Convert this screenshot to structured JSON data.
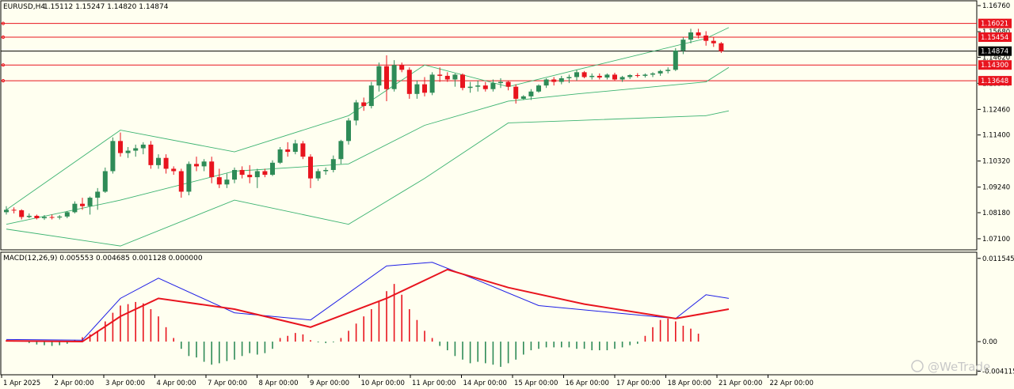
{
  "header": {
    "symbol": "EURUSD,H4",
    "ohlc": "1.15112 1.15247 1.14820 1.14874"
  },
  "macd_header": "MACD(12,26,9) 0.005553 0.004685 0.001128 0.000000",
  "watermark": "@WeTrade",
  "colors": {
    "background": "#fffff0",
    "bull": "#2e8b57",
    "bear": "#e8141e",
    "band": "#3cb371",
    "level": "#e8141e",
    "macd_line": "#1e1ee6",
    "signal_line": "#e8141e",
    "macd_hist": "#e8141e"
  },
  "chart_data": [
    {
      "type": "candlestick",
      "title": "EURUSD,H4",
      "ylim": [
        1.0664,
        1.1696
      ],
      "yticks": [
        "1.16760",
        "1.15680",
        "1.14620",
        "1.13540",
        "1.12460",
        "1.11400",
        "1.10320",
        "1.09240",
        "1.08180",
        "1.07100"
      ],
      "xticks": [
        "1 Apr 2025",
        "2 Apr 00:00",
        "3 Apr 00:00",
        "4 Apr 00:00",
        "7 Apr 00:00",
        "8 Apr 00:00",
        "9 Apr 00:00",
        "10 Apr 00:00",
        "11 Apr 00:00",
        "14 Apr 00:00",
        "15 Apr 00:00",
        "16 Apr 00:00",
        "17 Apr 00:00",
        "18 Apr 00:00",
        "21 Apr 00:00",
        "22 Apr 00:00"
      ],
      "price_levels": [
        {
          "value": 1.16021,
          "label": "1.16021",
          "style": "red"
        },
        {
          "value": 1.15454,
          "label": "1.15454",
          "style": "red"
        },
        {
          "value": 1.14874,
          "label": "1.14874",
          "style": "current"
        },
        {
          "value": 1.143,
          "label": "1.14300",
          "style": "red"
        },
        {
          "value": 1.13648,
          "label": "1.13648",
          "style": "red"
        }
      ],
      "candles": [
        [
          1.082,
          1.0845,
          1.081,
          1.083
        ],
        [
          1.083,
          1.084,
          1.0815,
          1.0828
        ],
        [
          1.0828,
          1.0832,
          1.079,
          1.08
        ],
        [
          1.08,
          1.0815,
          1.0795,
          1.0805
        ],
        [
          1.0805,
          1.081,
          1.079,
          1.0795
        ],
        [
          1.0795,
          1.0808,
          1.0788,
          1.08
        ],
        [
          1.08,
          1.081,
          1.079,
          1.0798
        ],
        [
          1.0798,
          1.0808,
          1.079,
          1.0802
        ],
        [
          1.0802,
          1.0825,
          1.0795,
          1.082
        ],
        [
          1.082,
          1.0865,
          1.0815,
          1.0855
        ],
        [
          1.0855,
          1.088,
          1.083,
          1.0845
        ],
        [
          1.0845,
          1.0885,
          1.081,
          1.088
        ],
        [
          1.088,
          1.092,
          1.083,
          1.0905
        ],
        [
          1.0905,
          1.1005,
          1.09,
          1.099
        ],
        [
          1.099,
          1.113,
          1.098,
          1.1115
        ],
        [
          1.1115,
          1.115,
          1.105,
          1.1065
        ],
        [
          1.1065,
          1.109,
          1.1045,
          1.1075
        ],
        [
          1.1075,
          1.11,
          1.105,
          1.1085
        ],
        [
          1.1085,
          1.111,
          1.106,
          1.11
        ],
        [
          1.11,
          1.1115,
          1.1,
          1.1015
        ],
        [
          1.1015,
          1.106,
          1.1,
          1.1045
        ],
        [
          1.1045,
          1.106,
          1.098,
          1.1
        ],
        [
          1.1,
          1.101,
          1.0975,
          1.099
        ],
        [
          1.099,
          1.1,
          1.088,
          1.0905
        ],
        [
          1.0905,
          1.103,
          1.089,
          1.102
        ],
        [
          1.102,
          1.105,
          1.099,
          1.101
        ],
        [
          1.101,
          1.104,
          1.099,
          1.103
        ],
        [
          1.103,
          1.105,
          1.094,
          1.0965
        ],
        [
          1.0965,
          1.1,
          1.092,
          1.0935
        ],
        [
          1.0935,
          1.098,
          1.092,
          1.0955
        ],
        [
          1.0955,
          1.1005,
          1.094,
          1.0995
        ],
        [
          1.0995,
          1.101,
          1.096,
          1.0975
        ],
        [
          1.0975,
          1.1015,
          1.094,
          1.0965
        ],
        [
          1.0965,
          1.1,
          1.092,
          1.099
        ],
        [
          1.099,
          1.1,
          1.0965,
          1.0975
        ],
        [
          1.0975,
          1.1035,
          1.097,
          1.1025
        ],
        [
          1.1025,
          1.109,
          1.102,
          1.108
        ],
        [
          1.108,
          1.111,
          1.105,
          1.107
        ],
        [
          1.107,
          1.112,
          1.106,
          1.1105
        ],
        [
          1.1105,
          1.1115,
          1.104,
          1.105
        ],
        [
          1.105,
          1.106,
          1.092,
          1.096
        ],
        [
          1.096,
          1.1,
          1.095,
          1.099
        ],
        [
          1.099,
          1.1005,
          1.0975,
          1.0995
        ],
        [
          1.0995,
          1.1055,
          1.0985,
          1.104
        ],
        [
          1.104,
          1.112,
          1.102,
          1.1115
        ],
        [
          1.1115,
          1.121,
          1.11,
          1.12
        ],
        [
          1.12,
          1.1285,
          1.118,
          1.1275
        ],
        [
          1.1275,
          1.1295,
          1.124,
          1.126
        ],
        [
          1.126,
          1.136,
          1.125,
          1.1345
        ],
        [
          1.1345,
          1.144,
          1.132,
          1.1425
        ],
        [
          1.1425,
          1.147,
          1.128,
          1.133
        ],
        [
          1.133,
          1.145,
          1.132,
          1.143
        ],
        [
          1.143,
          1.144,
          1.14,
          1.141
        ],
        [
          1.141,
          1.142,
          1.129,
          1.131
        ],
        [
          1.131,
          1.1365,
          1.129,
          1.135
        ],
        [
          1.135,
          1.138,
          1.13,
          1.1315
        ],
        [
          1.1315,
          1.14,
          1.1305,
          1.139
        ],
        [
          1.139,
          1.142,
          1.136,
          1.1385
        ],
        [
          1.1385,
          1.14,
          1.136,
          1.137
        ],
        [
          1.137,
          1.1395,
          1.134,
          1.139
        ],
        [
          1.139,
          1.1395,
          1.1325,
          1.1335
        ],
        [
          1.1335,
          1.136,
          1.1315,
          1.134
        ],
        [
          1.134,
          1.1365,
          1.132,
          1.1345
        ],
        [
          1.1345,
          1.136,
          1.132,
          1.133
        ],
        [
          1.133,
          1.137,
          1.132,
          1.1355
        ],
        [
          1.1355,
          1.1375,
          1.1335,
          1.136
        ],
        [
          1.136,
          1.1365,
          1.1325,
          1.134
        ],
        [
          1.134,
          1.135,
          1.127,
          1.129
        ],
        [
          1.129,
          1.1305,
          1.1285,
          1.13
        ],
        [
          1.13,
          1.133,
          1.1285,
          1.132
        ],
        [
          1.132,
          1.135,
          1.1315,
          1.1345
        ],
        [
          1.1345,
          1.1375,
          1.1335,
          1.137
        ],
        [
          1.137,
          1.138,
          1.1345,
          1.136
        ],
        [
          1.136,
          1.1385,
          1.135,
          1.1375
        ],
        [
          1.1375,
          1.139,
          1.1355,
          1.138
        ],
        [
          1.138,
          1.141,
          1.1365,
          1.14
        ],
        [
          1.14,
          1.1405,
          1.1375,
          1.138
        ],
        [
          1.138,
          1.1395,
          1.137,
          1.1385
        ],
        [
          1.1385,
          1.1395,
          1.137,
          1.1378
        ],
        [
          1.1378,
          1.1395,
          1.137,
          1.139
        ],
        [
          1.139,
          1.1398,
          1.1365,
          1.137
        ],
        [
          1.137,
          1.1385,
          1.136,
          1.138
        ],
        [
          1.138,
          1.1392,
          1.1372,
          1.1388
        ],
        [
          1.1388,
          1.1396,
          1.1378,
          1.1385
        ],
        [
          1.1385,
          1.1395,
          1.1378,
          1.139
        ],
        [
          1.139,
          1.14,
          1.138,
          1.1395
        ],
        [
          1.1395,
          1.141,
          1.1385,
          1.1405
        ],
        [
          1.1405,
          1.142,
          1.1395,
          1.141
        ],
        [
          1.141,
          1.15,
          1.1405,
          1.149
        ],
        [
          1.149,
          1.1545,
          1.1475,
          1.1535
        ],
        [
          1.1535,
          1.158,
          1.152,
          1.1565
        ],
        [
          1.1565,
          1.158,
          1.154,
          1.1552
        ],
        [
          1.1552,
          1.157,
          1.151,
          1.153
        ],
        [
          1.153,
          1.1545,
          1.1505,
          1.152
        ],
        [
          1.152,
          1.1525,
          1.148,
          1.1487
        ]
      ],
      "bollinger": {
        "upper": [
          [
            0,
            1.083
          ],
          [
            15,
            1.116
          ],
          [
            30,
            1.107
          ],
          [
            45,
            1.122
          ],
          [
            55,
            1.143
          ],
          [
            66,
            1.134
          ],
          [
            75,
            1.141
          ],
          [
            92,
            1.154
          ],
          [
            95,
            1.1585
          ]
        ],
        "middle": [
          [
            0,
            1.077
          ],
          [
            15,
            1.087
          ],
          [
            30,
            1.099
          ],
          [
            45,
            1.102
          ],
          [
            55,
            1.118
          ],
          [
            66,
            1.128
          ],
          [
            75,
            1.131
          ],
          [
            92,
            1.136
          ],
          [
            95,
            1.142
          ]
        ],
        "lower": [
          [
            0,
            1.075
          ],
          [
            15,
            1.068
          ],
          [
            30,
            1.087
          ],
          [
            45,
            1.077
          ],
          [
            55,
            1.096
          ],
          [
            66,
            1.119
          ],
          [
            75,
            1.12
          ],
          [
            92,
            1.122
          ],
          [
            95,
            1.124
          ]
        ]
      }
    },
    {
      "type": "macd",
      "title": "MACD(12,26,9)",
      "ylim": [
        -0.0046,
        0.0124
      ],
      "yticks": [
        "0.011545",
        "0.00",
        "-0.004115"
      ],
      "values": {
        "macd": 0.005553,
        "signal": 0.004685,
        "histogram": 0.001128,
        "zero": 0.0
      },
      "histogram": [
        0.0002,
        0.0001,
        0.0,
        -0.0002,
        -0.0004,
        -0.0005,
        -0.0006,
        -0.0005,
        -0.0003,
        0.0002,
        0.0006,
        0.001,
        0.0015,
        0.0028,
        0.004,
        0.005,
        0.0052,
        0.0055,
        0.0053,
        0.0045,
        0.0035,
        0.002,
        0.0005,
        -0.001,
        -0.002,
        -0.0022,
        -0.0028,
        -0.0032,
        -0.003,
        -0.0027,
        -0.0025,
        -0.002,
        -0.0016,
        -0.0018,
        -0.0016,
        -0.001,
        0.0005,
        0.0008,
        0.0012,
        0.001,
        0.0002,
        -0.0001,
        -0.0002,
        -0.0001,
        0.0005,
        0.0015,
        0.0025,
        0.0035,
        0.0045,
        0.0055,
        0.007,
        0.008,
        0.0065,
        0.0045,
        0.003,
        0.0015,
        0.0005,
        -0.0006,
        -0.0012,
        -0.002,
        -0.0025,
        -0.003,
        -0.0028,
        -0.003,
        -0.0032,
        -0.0035,
        -0.003,
        -0.0025,
        -0.0018,
        -0.0012,
        -0.001,
        -0.0008,
        -0.0008,
        -0.0008,
        -0.0008,
        -0.001,
        -0.001,
        -0.0012,
        -0.0012,
        -0.0012,
        -0.001,
        -0.0008,
        -0.0005,
        -0.0003,
        0.0008,
        0.002,
        0.003,
        0.0032,
        0.0028,
        0.0022,
        0.0018,
        0.0011
      ],
      "macd_line": [
        [
          0,
          0.0003
        ],
        [
          10,
          0.0002
        ],
        [
          15,
          0.006
        ],
        [
          20,
          0.0088
        ],
        [
          30,
          0.004
        ],
        [
          40,
          0.003
        ],
        [
          50,
          0.0105
        ],
        [
          56,
          0.011
        ],
        [
          62,
          0.0085
        ],
        [
          70,
          0.005
        ],
        [
          80,
          0.004
        ],
        [
          88,
          0.0032
        ],
        [
          92,
          0.0065
        ],
        [
          95,
          0.006
        ]
      ],
      "signal_line": [
        [
          0,
          0.0001
        ],
        [
          10,
          0.0
        ],
        [
          15,
          0.0035
        ],
        [
          20,
          0.006
        ],
        [
          30,
          0.0045
        ],
        [
          40,
          0.002
        ],
        [
          50,
          0.006
        ],
        [
          58,
          0.01
        ],
        [
          66,
          0.0075
        ],
        [
          76,
          0.0052
        ],
        [
          88,
          0.0032
        ],
        [
          95,
          0.0045
        ]
      ]
    }
  ]
}
